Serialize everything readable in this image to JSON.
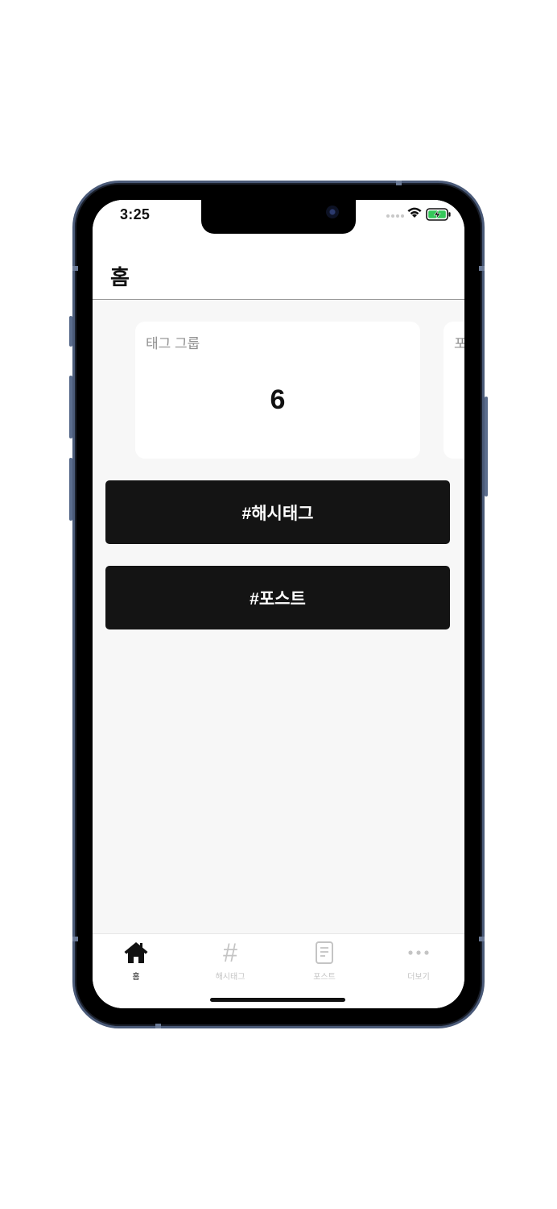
{
  "status_bar": {
    "time": "3:25"
  },
  "header": {
    "title": "홈"
  },
  "cards": [
    {
      "label": "태그 그룹",
      "value": "6"
    },
    {
      "label": "포"
    }
  ],
  "actions": {
    "hashtag_label": "#해시태그",
    "post_label": "#포스트"
  },
  "tab_bar": {
    "tabs": [
      {
        "label": "홈",
        "icon": "home-icon",
        "active": true
      },
      {
        "label": "해시태그",
        "icon": "hash-icon",
        "active": false
      },
      {
        "label": "포스트",
        "icon": "document-icon",
        "active": false
      },
      {
        "label": "더보기",
        "icon": "more-icon",
        "active": false
      }
    ]
  },
  "colors": {
    "button_bg": "#141414",
    "screen_bg": "#f7f7f7",
    "inactive_tab": "#c4c4c4",
    "frame": "#4a5a78"
  }
}
